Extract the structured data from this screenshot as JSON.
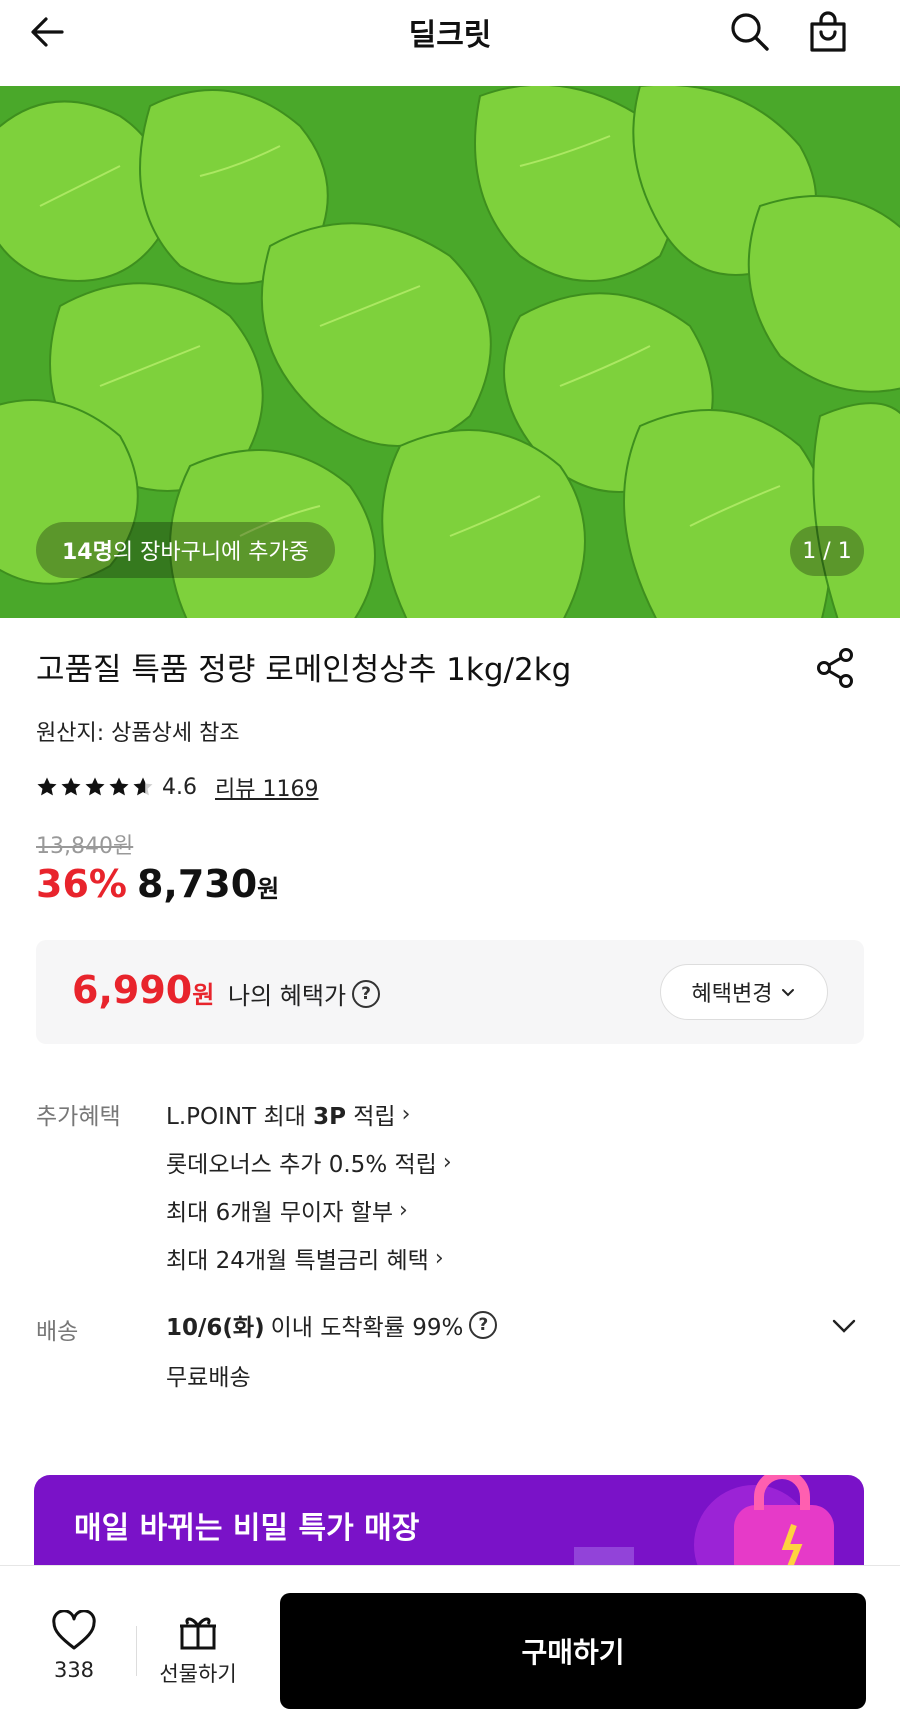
{
  "header": {
    "title": "딜크릿",
    "back_icon": "arrow-left-icon",
    "search_icon": "search-icon",
    "cart_icon": "shopping-bag-icon"
  },
  "hero": {
    "cart_count": "14명",
    "cart_text": "의 장바구니에 추가중",
    "page_indicator": "1 / 1"
  },
  "product": {
    "title": "고품질 특품 정량 로메인청상추 1kg/2kg",
    "origin": "원산지: 상품상세 참조",
    "rating": "4.6",
    "rating_stars": 4.6,
    "review_link": "리뷰 1169",
    "original_price": "13,840원",
    "discount": "36%",
    "sale_price": "8,730",
    "sale_unit": "원"
  },
  "benefit_box": {
    "price": "6,990",
    "unit": "원",
    "label": "나의 혜택가",
    "change_button": "혜택변경"
  },
  "extra_benefits": {
    "label": "추가혜택",
    "items": [
      {
        "pre": "L.POINT 최대 ",
        "bold": "3P",
        "post": " 적립"
      },
      {
        "pre": "롯데오너스 추가 0.5% 적립",
        "bold": "",
        "post": ""
      },
      {
        "pre": "최대 6개월 무이자 할부",
        "bold": "",
        "post": ""
      },
      {
        "pre": "최대 24개월 특별금리 혜택",
        "bold": "",
        "post": ""
      }
    ]
  },
  "shipping": {
    "label": "배송",
    "date": "10/6(화)",
    "text": "이내 도착확률 99%",
    "free": "무료배송"
  },
  "banner": {
    "text": "매일 바뀌는 비밀 특가 매장"
  },
  "bottom_bar": {
    "wish_count": "338",
    "gift_label": "선물하기",
    "buy_label": "구매하기"
  },
  "colors": {
    "accent_red": "#e8242c",
    "banner_purple": "#7a12c8",
    "buy_black": "#000000"
  }
}
